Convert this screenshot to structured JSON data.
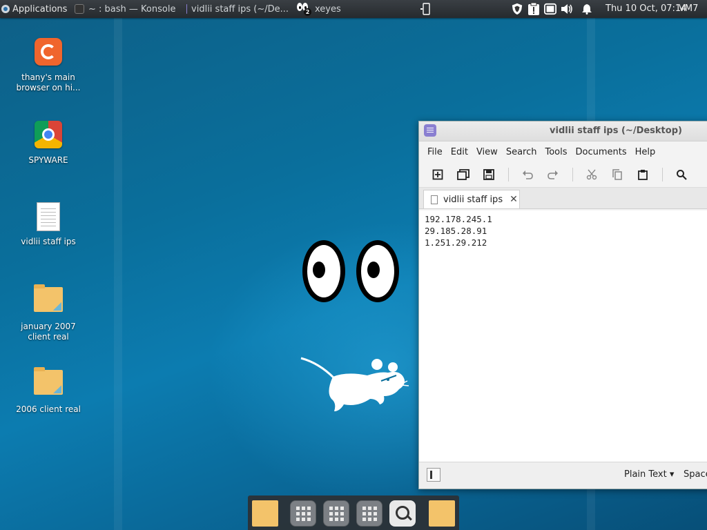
{
  "panel": {
    "applications_label": "Applications",
    "tasks": [
      {
        "label": "~ : bash — Konsole"
      },
      {
        "label": "vidlii staff ips (~/De..."
      },
      {
        "label": "xeyes",
        "badge": "2"
      }
    ],
    "clock": "Thu 10 Oct, 07:14",
    "vm_label": "VM7"
  },
  "desktop_icons": [
    {
      "label_line1": "thany's main",
      "label_line2": "browser on hi...",
      "icon": "firefox-icon"
    },
    {
      "label_line1": "SPYWARE",
      "label_line2": "",
      "icon": "chrome-icon"
    },
    {
      "label_line1": "vidlii staff ips",
      "label_line2": "",
      "icon": "text-document-icon"
    },
    {
      "label_line1": "january 2007",
      "label_line2": "client real",
      "icon": "folder-icon"
    },
    {
      "label_line1": "2006 client real",
      "label_line2": "",
      "icon": "folder-icon"
    }
  ],
  "editor_window": {
    "title": "vidlii staff ips (~/Desktop)",
    "menu": [
      "File",
      "Edit",
      "View",
      "Search",
      "Tools",
      "Documents",
      "Help"
    ],
    "tab_label": "vidlii staff ips",
    "lines": [
      "192.178.245.1",
      "29.185.28.91",
      "1.251.29.212"
    ],
    "status_language": "Plain Text ▾",
    "status_spaces": "Space"
  },
  "colors": {
    "desktop_bg": "#0a6f9c",
    "panel_bg": "#2f3337",
    "dock_bg": "#2d3034",
    "folder": "#f3c36a",
    "editor_accent": "#8a7fd1"
  }
}
